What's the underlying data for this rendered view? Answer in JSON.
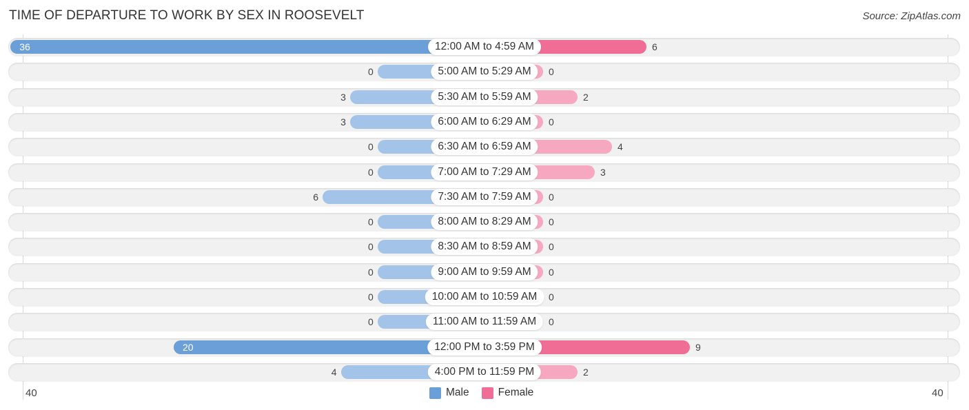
{
  "chart_data": {
    "type": "bar",
    "orientation": "horizontal-diverging",
    "title": "TIME OF DEPARTURE TO WORK BY SEX IN ROOSEVELT",
    "source": "Source: ZipAtlas.com",
    "categories": [
      "12:00 AM to 4:59 AM",
      "5:00 AM to 5:29 AM",
      "5:30 AM to 5:59 AM",
      "6:00 AM to 6:29 AM",
      "6:30 AM to 6:59 AM",
      "7:00 AM to 7:29 AM",
      "7:30 AM to 7:59 AM",
      "8:00 AM to 8:29 AM",
      "8:30 AM to 8:59 AM",
      "9:00 AM to 9:59 AM",
      "10:00 AM to 10:59 AM",
      "11:00 AM to 11:59 AM",
      "12:00 PM to 3:59 PM",
      "4:00 PM to 11:59 PM"
    ],
    "series": [
      {
        "name": "Male",
        "color": "#6a9fd8",
        "values": [
          36,
          0,
          3,
          3,
          0,
          0,
          6,
          0,
          0,
          0,
          0,
          0,
          20,
          4
        ]
      },
      {
        "name": "Female",
        "color": "#f06d96",
        "values": [
          6,
          0,
          2,
          0,
          4,
          3,
          0,
          0,
          0,
          0,
          0,
          0,
          9,
          2
        ]
      }
    ],
    "xlim": [
      40,
      40
    ],
    "axis_ticks": {
      "left": "40",
      "right": "40"
    },
    "legend": {
      "position": "bottom-center",
      "entries": [
        "Male",
        "Female"
      ]
    }
  }
}
